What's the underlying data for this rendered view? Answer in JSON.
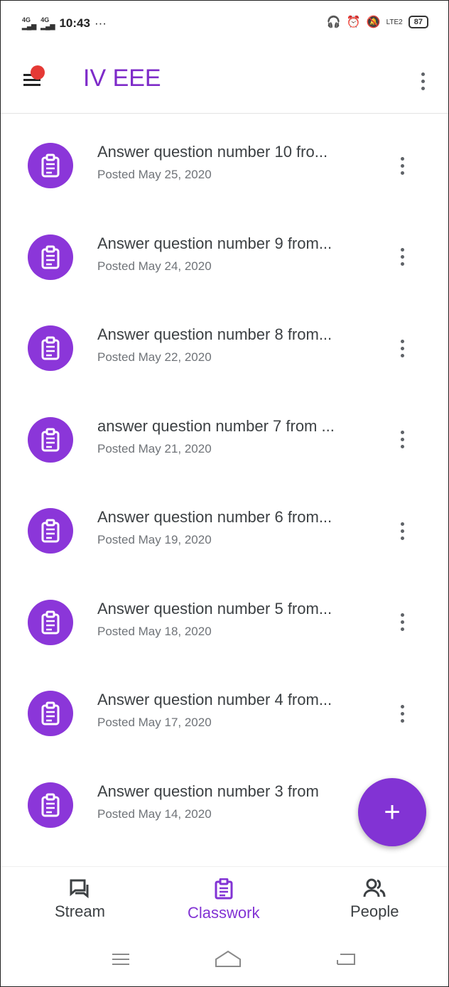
{
  "status_bar": {
    "time": "10:43",
    "signal_1": "4G",
    "signal_2": "4G",
    "extra": "···",
    "network": "LTE2",
    "battery": "87"
  },
  "app_bar": {
    "title": "IV EEE",
    "accent_color": "#7e2bc9"
  },
  "assignments": [
    {
      "title": "Answer question number 10 fro...",
      "date": "Posted May 25, 2020"
    },
    {
      "title": "Answer question number 9 from...",
      "date": "Posted May 24, 2020"
    },
    {
      "title": "Answer question number 8 from...",
      "date": "Posted May 22, 2020"
    },
    {
      "title": "answer question number 7 from ...",
      "date": "Posted May 21, 2020"
    },
    {
      "title": "Answer question number 6 from...",
      "date": "Posted May 19, 2020"
    },
    {
      "title": "Answer question number 5 from...",
      "date": "Posted May 18, 2020"
    },
    {
      "title": "Answer question number 4 from...",
      "date": "Posted May 17, 2020"
    },
    {
      "title": "Answer question number 3 from",
      "date": "Posted May 14, 2020"
    }
  ],
  "fab": {
    "label": "+"
  },
  "bottom_nav": {
    "stream": "Stream",
    "classwork": "Classwork",
    "people": "People",
    "active": "Classwork"
  },
  "icons": {
    "assignment": "assignment-icon",
    "more": "more-vertical-icon",
    "menu": "menu-icon",
    "stream": "stream-icon",
    "classwork": "classwork-icon",
    "people": "people-icon"
  }
}
